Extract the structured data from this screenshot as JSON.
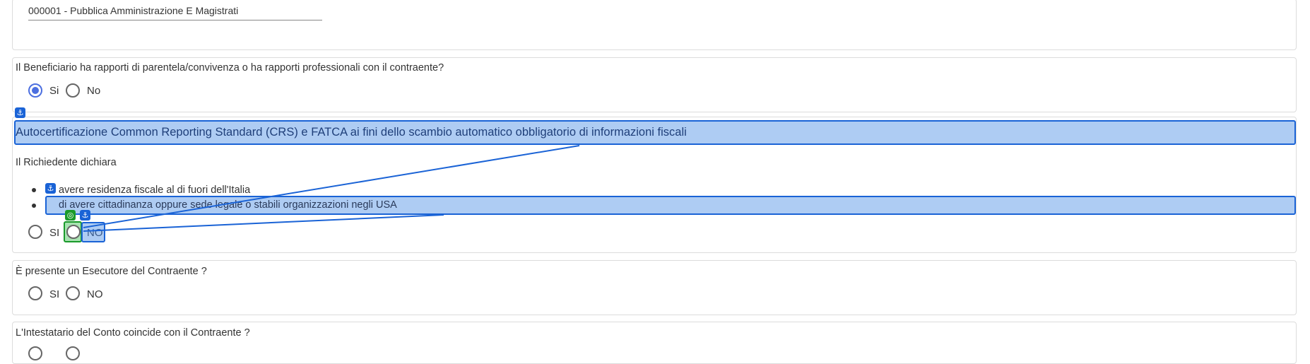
{
  "beneficiary": {
    "value": "000001 - Pubblica Amministrazione E Magistrati"
  },
  "q_parentela": {
    "question": "Il Beneficiario ha rapporti di parentela/convivenza o ha rapporti professionali con il contraente?",
    "options": [
      "Si",
      "No"
    ],
    "selected": "Si"
  },
  "crs": {
    "title": "Autocertificazione Common Reporting Standard (CRS) e FATCA ai fini dello scambio automatico obbligatorio di informazioni fiscali",
    "subtitle": "Il Richiedente dichiara",
    "bullets": [
      "avere residenza fiscale al di fuori dell'Italia",
      "di avere cittadinanza oppure sede legale o stabili organizzazioni negli USA"
    ],
    "options": [
      "SI",
      "NO"
    ],
    "selected": null
  },
  "q_esecutore": {
    "question": "È presente un Esecutore del Contraente ?",
    "options": [
      "SI",
      "NO"
    ],
    "selected": null
  },
  "q_intestatario": {
    "question": "L'Intestatario del Conto coincide con il Contraente ?"
  },
  "overlay": {
    "anchor_icon": "anchor-icon",
    "target_icon": "target-icon",
    "colors": {
      "blue": "#1a63d6",
      "green": "#1a9a2a",
      "radio_accent": "#4c6fe0"
    }
  }
}
